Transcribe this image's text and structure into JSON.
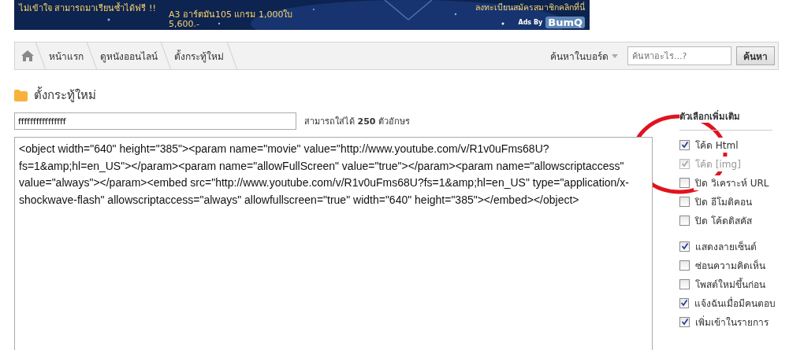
{
  "banner": {
    "texts": [
      {
        "text": "ไม่เข้าใจ สามารถมาเรียนซ้ำได้ฟรี !!",
        "kind": "left"
      },
      {
        "text": "A3 อาร์ตมัน105 แกรม 1,000ใบ",
        "kind": "mid"
      },
      {
        "text": "5,600.-",
        "kind": "mid"
      },
      {
        "text": "ลงทะเบียนสมัครสมาชิกคลิกที่นี่",
        "kind": "right"
      }
    ],
    "ads_by": "Ads By",
    "logo": "BumQ"
  },
  "breadcrumbs": [
    "หน้าแรก",
    "ดูหนังออนไลน์",
    "ตั้งกระทู้ใหม่"
  ],
  "board_search": {
    "scope": "ค้นหาในบอร์ด",
    "placeholder": "ค้นหาอะไร...?",
    "button": "ค้นหา"
  },
  "page_title": "ตั้งกระทู้ใหม่",
  "subject": {
    "value": "ffffffffffffffff",
    "hint_prefix": "สามารถใส่ได้",
    "hint_count": "250",
    "hint_suffix": "ตัวอักษร"
  },
  "body": {
    "value": "<object width=\"640\" height=\"385\"><param name=\"movie\" value=\"http://www.youtube.com/v/R1v0uFms68U?fs=1&amp;hl=en_US\"></param><param name=\"allowFullScreen\" value=\"true\"></param><param name=\"allowscriptaccess\" value=\"always\"></param><embed src=\"http://www.youtube.com/v/R1v0uFms68U?fs=1&amp;hl=en_US\" type=\"application/x-shockwave-flash\" allowscriptaccess=\"always\" allowfullscreen=\"true\" width=\"640\" height=\"385\"></embed></object>"
  },
  "options": {
    "title": "ตัวเลือกเพิ่มเติม",
    "groups": [
      [
        {
          "label": "โค้ด Html",
          "checked": true,
          "disabled": false
        },
        {
          "label": "โค้ด [img]",
          "checked": true,
          "disabled": true
        },
        {
          "label": "ปิด วิเคราะห์ URL",
          "checked": false,
          "disabled": false
        },
        {
          "label": "ปิด อีโมติคอน",
          "checked": false,
          "disabled": false
        },
        {
          "label": "ปิด โค้ดดิสคัส",
          "checked": false,
          "disabled": false
        }
      ],
      [
        {
          "label": "แสดงลายเซ็นต์",
          "checked": true,
          "disabled": false
        },
        {
          "label": "ซ่อนความคิดเห็น",
          "checked": false,
          "disabled": false
        },
        {
          "label": "โพสต์ใหม่ขึ้นก่อน",
          "checked": false,
          "disabled": false
        },
        {
          "label": "แจ้งฉันเมื่อมีคนตอบ",
          "checked": true,
          "disabled": false
        },
        {
          "label": "เพิ่มเข้าในรายการ",
          "checked": true,
          "disabled": false
        }
      ]
    ]
  },
  "annotation": {
    "kind": "circle"
  }
}
